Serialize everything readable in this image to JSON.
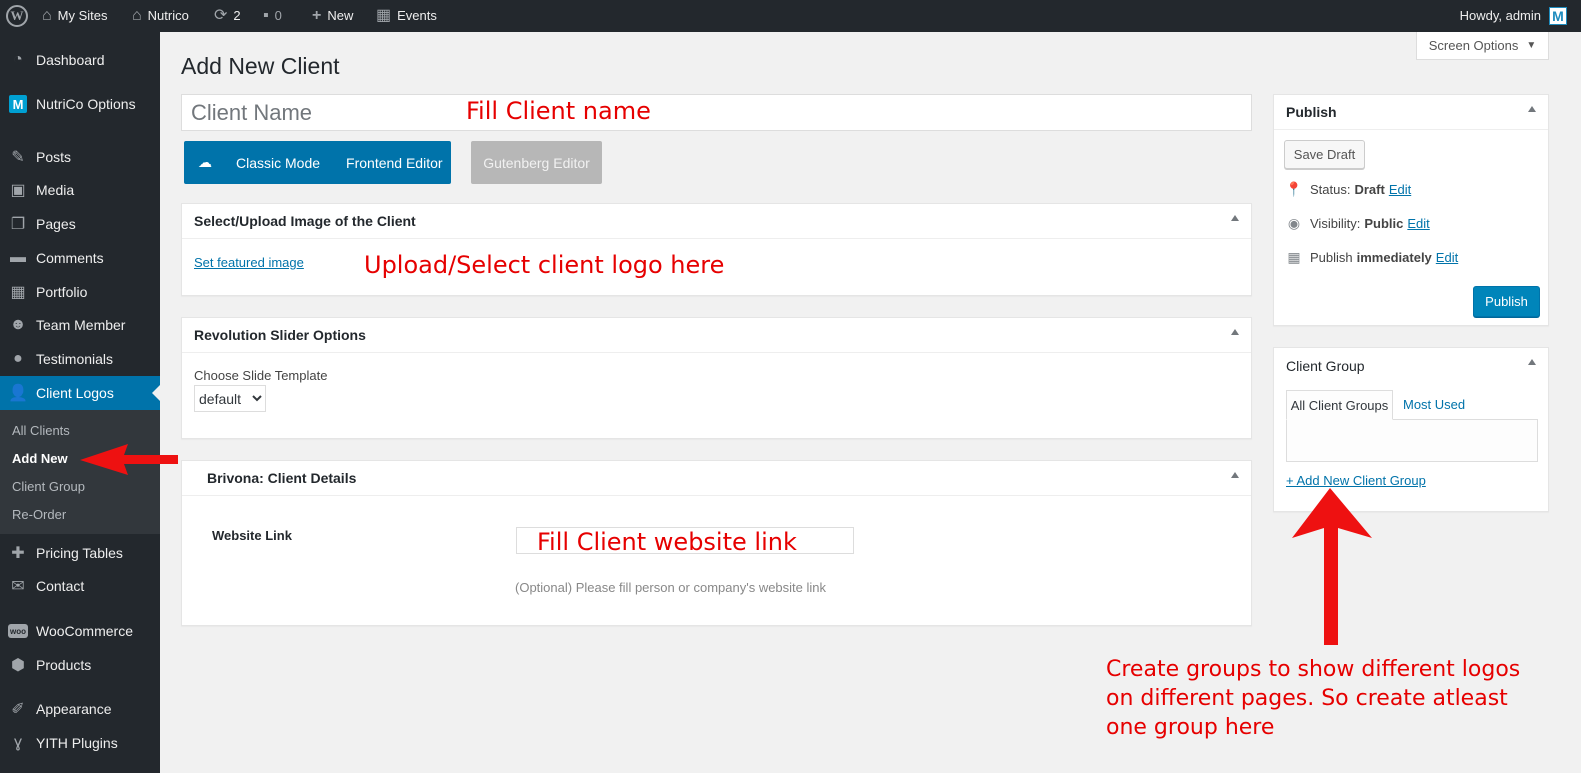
{
  "adminbar": {
    "my_sites": "My Sites",
    "site_name": "Nutrico",
    "updates_count": "2",
    "comments_count": "0",
    "new_label": "New",
    "events_label": "Events",
    "howdy": "Howdy, admin",
    "avatar_letter": "M"
  },
  "sidebar": {
    "items": [
      {
        "label": "Dashboard"
      },
      {
        "label": "NutriCo Options",
        "icon_letter": "M"
      },
      {
        "label": "Posts"
      },
      {
        "label": "Media"
      },
      {
        "label": "Pages"
      },
      {
        "label": "Comments"
      },
      {
        "label": "Portfolio"
      },
      {
        "label": "Team Member"
      },
      {
        "label": "Testimonials"
      },
      {
        "label": "Client Logos"
      },
      {
        "label": "Pricing Tables"
      },
      {
        "label": "Contact"
      },
      {
        "label": "WooCommerce",
        "icon_text": "woo"
      },
      {
        "label": "Products"
      },
      {
        "label": "Appearance"
      },
      {
        "label": "YITH Plugins"
      }
    ],
    "submenu": [
      "All Clients",
      "Add New",
      "Client Group",
      "Re-Order"
    ]
  },
  "screen_options": "Screen Options",
  "page_title": "Add New Client",
  "title_input": {
    "placeholder": "Client Name"
  },
  "editor_buttons": {
    "classic": "Classic Mode",
    "frontend": "Frontend Editor",
    "gutenberg": "Gutenberg Editor"
  },
  "featured_box": {
    "title": "Select/Upload Image of the Client",
    "link": "Set featured image"
  },
  "slider_box": {
    "title": "Revolution Slider Options",
    "label": "Choose Slide Template",
    "selected": "default"
  },
  "details_box": {
    "title": "Brivona: Client Details",
    "field_label": "Website Link",
    "hint": "(Optional) Please fill person or company's website link"
  },
  "publish_box": {
    "title": "Publish",
    "save_draft": "Save Draft",
    "status_label": "Status:",
    "status_value": "Draft",
    "visibility_label": "Visibility:",
    "visibility_value": "Public",
    "publish_label": "Publish",
    "publish_value": "immediately",
    "edit": "Edit",
    "publish_button": "Publish"
  },
  "group_box": {
    "title": "Client Group",
    "tab_all": "All Client Groups",
    "tab_most": "Most Used",
    "add_link": "+ Add New Client Group"
  },
  "annotations": {
    "client_name": "Fill Client name",
    "logo": "Upload/Select client logo here",
    "website": "Fill Client website link",
    "groups": "Create groups to show different logos on different pages. So create atleast one group here"
  },
  "colors": {
    "admin_dark": "#23282d",
    "accent": "#0073aa",
    "annotation": "#e60000",
    "background": "#f1f1f1"
  }
}
